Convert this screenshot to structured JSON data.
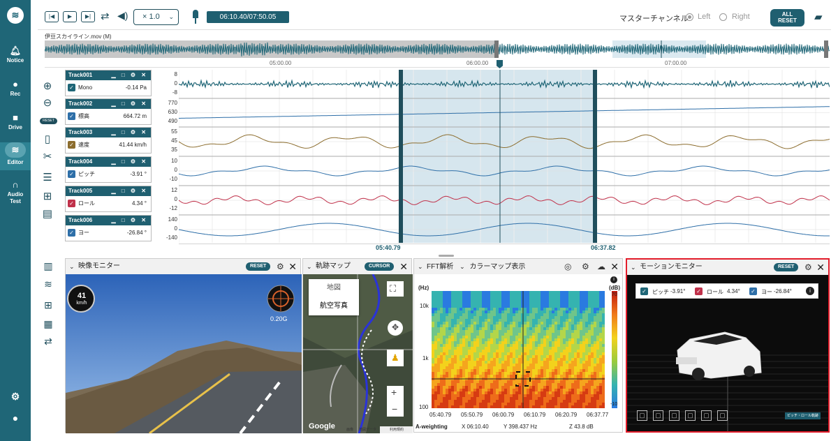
{
  "nav": {
    "items": [
      {
        "label": "Notice",
        "icon": "bell-icon"
      },
      {
        "label": "Rec",
        "icon": "mic-icon"
      },
      {
        "label": "Drive",
        "icon": "folder-icon"
      },
      {
        "label": "Editor",
        "icon": "waveform-icon"
      },
      {
        "label": "Audio Test",
        "icon": "headphones-icon"
      }
    ]
  },
  "toolbar": {
    "speed": "× 1.0",
    "time": "06:10.40/07:50.05",
    "master_label": "マスターチャンネル",
    "left": "Left",
    "right": "Right",
    "all_reset_1": "ALL",
    "all_reset_2": "RESET"
  },
  "file": {
    "name": "伊豆スカイライン.mov (M)"
  },
  "ruler": [
    "05:00.00",
    "06:00.00",
    "07:00.00"
  ],
  "tools": {
    "reset": "RESET"
  },
  "tracks": [
    {
      "name": "Track001",
      "label": "Mono",
      "value": "-0.14 Pa",
      "color": "#1f6677",
      "axis": [
        "8",
        "0",
        "-8"
      ]
    },
    {
      "name": "Track002",
      "label": "標高",
      "value": "664.72 m",
      "color": "#2e6fa8",
      "axis": [
        "770",
        "630",
        "490"
      ]
    },
    {
      "name": "Track003",
      "label": "速度",
      "value": "41.44 km/h",
      "color": "#8c6d2e",
      "axis": [
        "55",
        "45",
        "35"
      ]
    },
    {
      "name": "Track004",
      "label": "ピッチ",
      "value": "-3.91 °",
      "color": "#2e6fa8",
      "axis": [
        "10",
        "0",
        "-10"
      ]
    },
    {
      "name": "Track005",
      "label": "ロール",
      "value": "4.34 °",
      "color": "#c0314a",
      "axis": [
        "12",
        "0",
        "-12"
      ]
    },
    {
      "name": "Track006",
      "label": "ヨー",
      "value": "-26.84 °",
      "color": "#2e6fa8",
      "axis": [
        "140",
        "0",
        "-140"
      ]
    }
  ],
  "selection": {
    "start": "05:40.79",
    "end": "06:37.82"
  },
  "video": {
    "title": "映像モニター",
    "reset": "RESET",
    "speed_value": "41",
    "speed_unit": "km/h",
    "gforce": "0.20G"
  },
  "map": {
    "title": "軌跡マップ",
    "cursor": "CURSOR",
    "opt1": "地図",
    "opt2": "航空写真",
    "google": "Google",
    "footer": [
      "画像",
      "地図データ",
      "利用規約"
    ]
  },
  "fft": {
    "title": "FFT解析",
    "mode": "カラーマップ表示",
    "hz_label": "(Hz)",
    "db_label": "(dB)",
    "y_ticks": [
      "10k",
      "1k",
      "100"
    ],
    "db_ticks": [
      "70",
      "-10"
    ],
    "x_ticks": [
      "05:40.79",
      "05:50.79",
      "06:00.79",
      "06:10.79",
      "06:20.79",
      "06:37.77"
    ],
    "weighting": "A-weighting",
    "readout_x": "X 06:10.40",
    "readout_y": "Y 398.437 Hz",
    "readout_z": "Z 43.8 dB"
  },
  "motion": {
    "title": "モーションモニター",
    "reset": "RESET",
    "pitch_label": "ピッチ",
    "pitch": "-3.91°",
    "roll_label": "ロール",
    "roll": "4.34°",
    "yaw_label": "ヨー",
    "yaw": "-26.84°",
    "badge": "ピッチ・ロール軌跡"
  }
}
